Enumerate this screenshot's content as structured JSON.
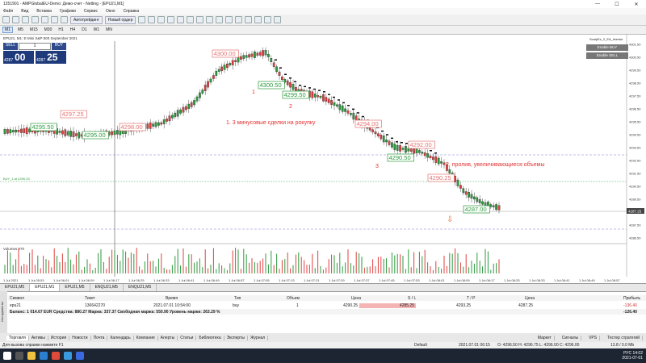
{
  "window": {
    "title": "1251901 - AMPGlobalEU-Demo: Демо-счет - Netting - [EPU21,M1]"
  },
  "menu": [
    "Файл",
    "Вид",
    "Вставка",
    "Графики",
    "Сервис",
    "Окно",
    "Справка"
  ],
  "toolbar": {
    "algo_label": "Автотрейдинг",
    "new_order_label": "Новый ордер"
  },
  "timeframes": [
    "M1",
    "M5",
    "M15",
    "M30",
    "H1",
    "H4",
    "D1",
    "W1",
    "MN"
  ],
  "active_timeframe": "M1",
  "chart": {
    "header": "EPU21, M1: E-Mini S&P 500 September 2021",
    "ea_name": "ScalpEz_2_EA_license",
    "enable_buy": "Enable BUY",
    "enable_sell": "Enable SELL",
    "volume_label": "Volumes 270",
    "buy_line_label": "BUY_1 at 4290.25",
    "price_axis": [
      "4301.50",
      "4300.50",
      "4299.50",
      "4298.50",
      "4297.50",
      "4296.50",
      "4295.50",
      "4294.50",
      "4293.50",
      "4292.50",
      "4291.50",
      "4290.50",
      "4289.50",
      "4288.50",
      "4287.50",
      "4286.50"
    ],
    "current_price": "4287.25",
    "time_axis": [
      "1 Jul 2021",
      "1 Jul 05:53",
      "1 Jul 06:01",
      "1 Jul 06:09",
      "1 Jul 06:17",
      "1 Jul 06:25",
      "1 Jul 06:33",
      "1 Jul 06:41",
      "1 Jul 06:49",
      "1 Jul 06:57",
      "1 Jul 07:05",
      "1 Jul 07:13",
      "1 Jul 07:21",
      "1 Jul 07:29",
      "1 Jul 07:37",
      "1 Jul 07:45",
      "1 Jul 07:53",
      "1 Jul 08:01",
      "1 Jul 08:09",
      "1 Jul 08:17",
      "1 Jul 08:25",
      "1 Jul 08:33",
      "1 Jul 08:41",
      "1 Jul 08:49",
      "1 Jul 08:57"
    ],
    "annotations": {
      "note1": "1. 3 минусовые сделки на рокупку",
      "note2": "2. пролив, увеличивающиеся объемы",
      "n1": "1",
      "n2": "2",
      "n3": "3"
    },
    "labels_green": [
      "4295.50",
      "4295.00",
      "4300.50",
      "4299.50",
      "4290.50",
      "4287.00"
    ],
    "labels_red": [
      "4297.25",
      "4298.00",
      "4300.00",
      "4294.00",
      "4292.00",
      "4290.25"
    ]
  },
  "trade_panel": {
    "sell": "SELL",
    "buy": "BUY",
    "lot": "1",
    "bid_small": "4287",
    "bid_big": "00",
    "ask_small": "4287",
    "ask_big": "25"
  },
  "chart_tabs": [
    "EPU21,M5",
    "EPU21,M1",
    "EPU21,M5",
    "ENQU21,M5",
    "ENQU21,M5"
  ],
  "active_chart_tab": "EPU21,M1",
  "terminal": {
    "headers": [
      "Символ",
      "Тикет",
      "Время",
      "Тип",
      "Объем",
      "Цена",
      "S / L",
      "T / P",
      "Цена",
      "Прибыль"
    ],
    "row": [
      "epu21",
      "136642270",
      "2021.07.01 10:54:00",
      "buy",
      "1",
      "4290.25",
      "4285.25",
      "4293.25",
      "4287.25",
      "-136.40"
    ],
    "balance": "Баланс: 1 014.67 EUR  Средства: 880.27  Маржа: 337.37  Свободная маржа: 550.90  Уровень маржи: 263.29 %",
    "total_profit": "-126.40",
    "side_label": "Инструменты"
  },
  "bottom_tabs": [
    "Торговля",
    "Активы",
    "История",
    "Новости",
    "Почта",
    "Календарь",
    "Компания",
    "Алерты",
    "Статьи",
    "Библиотека",
    "Эксперты",
    "Журнал"
  ],
  "bottom_right": [
    "Маркет",
    "Сигналы",
    "VPS",
    "Тестер стратегий"
  ],
  "status": {
    "help": "Для вызова справки нажмите F1",
    "profile": "Default",
    "datetime": "2021.07.01 06:15",
    "ohlc": "O: 4296.50   H: 4296.75   L: 4296.00   C: 4296.00",
    "ping": "13.8 / 0.0 Mb"
  },
  "tray": {
    "lang": "РУС",
    "time": "14:02",
    "date": "2021-07-01"
  },
  "colors": {
    "bull": "#2e9a3e",
    "bear": "#e04040",
    "buyline": "#2e9a3e",
    "grid": "#8080d0"
  }
}
